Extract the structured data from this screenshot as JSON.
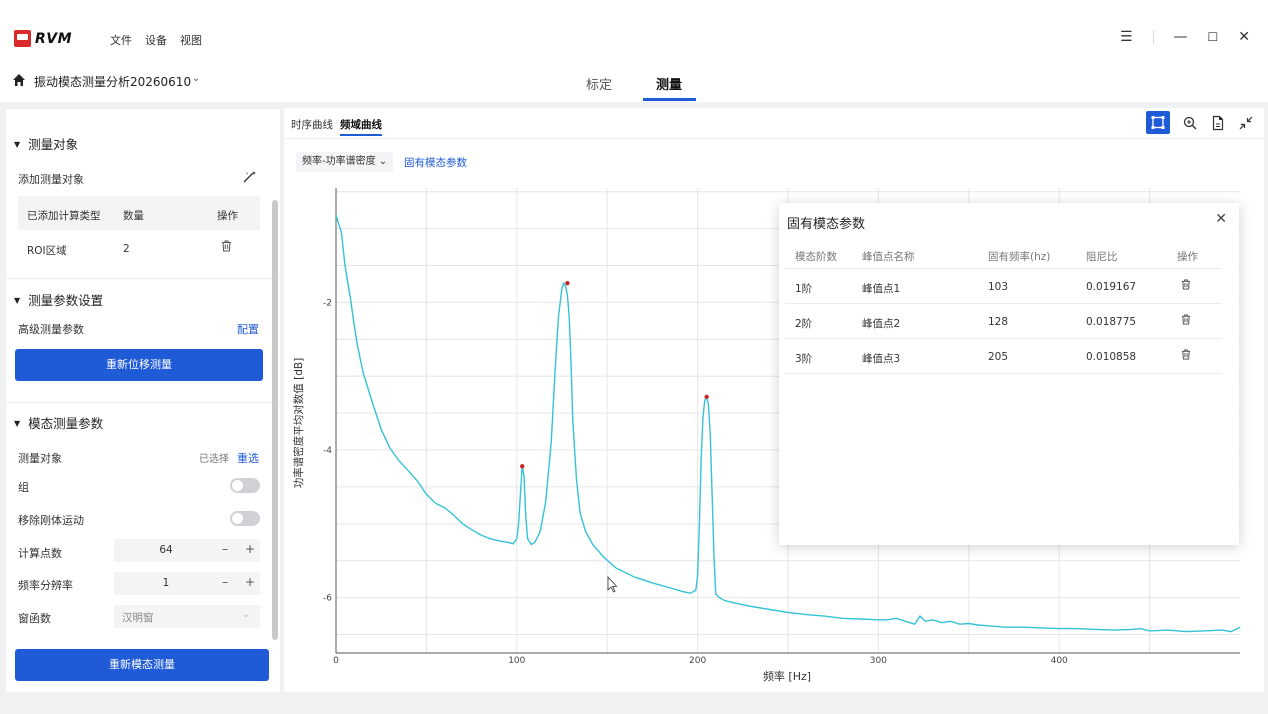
{
  "app": {
    "logo_text": "RVM",
    "menu": [
      "文件",
      "设备",
      "视图"
    ],
    "window_controls": [
      "menu-icon",
      "minimize-icon",
      "maximize-icon",
      "close-icon"
    ]
  },
  "project": {
    "title": "振动模态测量分析20260610",
    "tabs": [
      "标定",
      "测量"
    ],
    "active_tab": "测量"
  },
  "left": {
    "section1": {
      "title": "测量对象",
      "add_label": "添加测量对象",
      "table_headers": [
        "已添加计算类型",
        "数量",
        "操作"
      ],
      "rows": [
        {
          "type": "ROI区域",
          "count": "2"
        }
      ]
    },
    "section2": {
      "title": "测量参数设置",
      "advanced_label": "高级测量参数",
      "config_link": "配置",
      "button": "重新位移测量"
    },
    "section3": {
      "title": "模态测量参数",
      "object_label": "测量对象",
      "selected_text": "已选择",
      "reselect_link": "重选",
      "group_label": "组",
      "rigid_label": "移除刚体运动",
      "points_label": "计算点数",
      "points_value": "64",
      "resolution_label": "频率分辨率",
      "resolution_value": "1",
      "window_label": "窗函数",
      "window_value": "汉明窗",
      "button": "重新模态测量"
    }
  },
  "right": {
    "tabs": [
      "时序曲线",
      "频域曲线"
    ],
    "active_tab": "频域曲线",
    "dropdown": "频率-功率谱密度",
    "modal_link": "固有模态参数"
  },
  "modal": {
    "title": "固有模态参数",
    "headers": [
      "模态阶数",
      "峰值点名称",
      "固有频率(hz)",
      "阻尼比",
      "操作"
    ],
    "rows": [
      {
        "order": "1阶",
        "name": "峰值点1",
        "freq": "103",
        "damping": "0.019167"
      },
      {
        "order": "2阶",
        "name": "峰值点2",
        "freq": "128",
        "damping": "0.018775"
      },
      {
        "order": "3阶",
        "name": "峰值点3",
        "freq": "205",
        "damping": "0.010858"
      }
    ]
  },
  "chart_data": {
    "type": "line",
    "xlabel": "频率 [Hz]",
    "ylabel": "功率谱密度平均对数值 [dB]",
    "xlim": [
      0,
      500
    ],
    "ylim": [
      -6.75,
      -0.45
    ],
    "xticks": [
      0,
      100,
      200,
      300,
      400
    ],
    "yticks": [
      -2,
      -4,
      -6
    ],
    "grid": true,
    "line_color": "#33c3d6",
    "peak_color": "#c62828",
    "peaks": [
      {
        "x": 103,
        "y": -4.22
      },
      {
        "x": 128,
        "y": -1.74
      },
      {
        "x": 205,
        "y": -3.28
      }
    ],
    "series": [
      {
        "x": [
          0,
          3,
          5,
          8,
          10,
          12,
          15,
          20,
          25,
          30,
          35,
          40,
          45,
          50,
          55,
          60,
          65,
          70,
          75,
          80,
          85,
          90,
          95,
          98,
          100,
          101,
          102,
          103,
          104,
          105,
          106,
          108,
          110,
          113,
          116,
          119,
          121,
          123,
          125,
          126,
          127,
          128,
          129,
          130,
          131,
          133,
          135,
          138,
          142,
          148,
          155,
          165,
          175,
          185,
          192,
          196,
          199,
          200,
          201,
          202,
          203,
          204,
          205,
          206,
          207,
          208,
          209,
          210,
          212,
          215,
          220,
          230,
          240,
          250,
          260,
          270,
          280,
          290,
          300,
          305,
          310,
          315,
          320,
          323,
          326,
          330,
          335,
          340,
          345,
          350,
          355,
          360,
          370,
          380,
          390,
          400,
          410,
          420,
          430,
          440,
          445,
          450,
          460,
          470,
          480,
          490,
          495,
          500
        ],
        "y": [
          -0.82,
          -1.05,
          -1.5,
          -1.95,
          -2.3,
          -2.6,
          -2.95,
          -3.35,
          -3.72,
          -3.98,
          -4.15,
          -4.28,
          -4.42,
          -4.6,
          -4.72,
          -4.78,
          -4.88,
          -5.0,
          -5.08,
          -5.15,
          -5.2,
          -5.23,
          -5.25,
          -5.27,
          -5.2,
          -5.0,
          -4.6,
          -4.22,
          -4.35,
          -4.9,
          -5.2,
          -5.28,
          -5.25,
          -5.1,
          -4.7,
          -3.9,
          -3.0,
          -2.2,
          -1.8,
          -1.74,
          -1.78,
          -1.9,
          -2.2,
          -2.8,
          -3.6,
          -4.4,
          -4.85,
          -5.1,
          -5.28,
          -5.45,
          -5.6,
          -5.72,
          -5.8,
          -5.87,
          -5.92,
          -5.94,
          -5.9,
          -5.7,
          -5.0,
          -4.1,
          -3.55,
          -3.32,
          -3.28,
          -3.38,
          -3.8,
          -4.6,
          -5.4,
          -5.95,
          -6.0,
          -6.04,
          -6.07,
          -6.12,
          -6.16,
          -6.2,
          -6.23,
          -6.25,
          -6.28,
          -6.29,
          -6.3,
          -6.3,
          -6.28,
          -6.32,
          -6.36,
          -6.25,
          -6.32,
          -6.3,
          -6.34,
          -6.32,
          -6.36,
          -6.35,
          -6.37,
          -6.38,
          -6.4,
          -6.4,
          -6.41,
          -6.42,
          -6.42,
          -6.43,
          -6.44,
          -6.43,
          -6.42,
          -6.45,
          -6.44,
          -6.46,
          -6.45,
          -6.44,
          -6.46,
          -6.4
        ]
      }
    ]
  }
}
